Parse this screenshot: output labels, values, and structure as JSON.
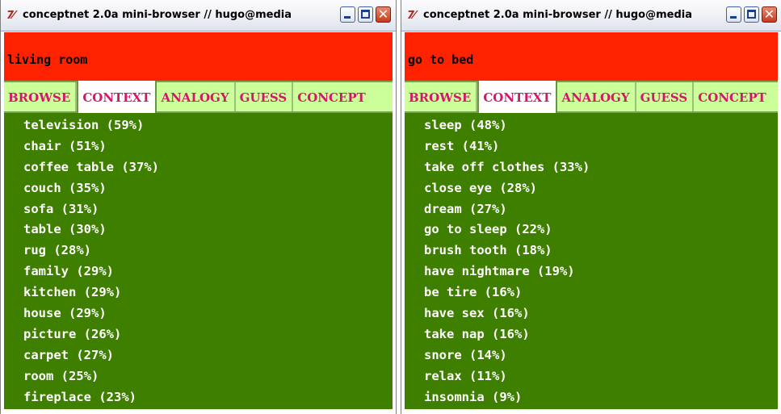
{
  "colors": {
    "input_bg": "#ff2200",
    "tab_bar_bg": "#ccff99",
    "tab_text": "#d5176b",
    "results_bg": "#3f7f00",
    "results_text": "#ffffff"
  },
  "windows": [
    {
      "title": "conceptnet 2.0a mini-browser // hugo@media",
      "app_icon": "tk-feather-icon",
      "concept": "living room",
      "tabs": [
        "BROWSE",
        "CONTEXT",
        "ANALOGY",
        "GUESS",
        "CONCEPT"
      ],
      "active_tab": "CONTEXT",
      "results": [
        "television (59%)",
        "chair (51%)",
        "coffee table (37%)",
        "couch (35%)",
        "sofa (31%)",
        "table (30%)",
        "rug (28%)",
        "family (29%)",
        "kitchen (29%)",
        "house (29%)",
        "picture (26%)",
        "carpet (27%)",
        "room (25%)",
        "fireplace (23%)"
      ]
    },
    {
      "title": "conceptnet 2.0a mini-browser // hugo@media",
      "app_icon": "tk-feather-icon",
      "concept": "go to bed",
      "tabs": [
        "BROWSE",
        "CONTEXT",
        "ANALOGY",
        "GUESS",
        "CONCEPT"
      ],
      "active_tab": "CONTEXT",
      "results": [
        "sleep (48%)",
        "rest (41%)",
        "take off clothes (33%)",
        "close eye (28%)",
        "dream (27%)",
        "go to sleep (22%)",
        "brush tooth (18%)",
        "have nightmare (19%)",
        "be tire (16%)",
        "have sex (16%)",
        "take nap (16%)",
        "snore (14%)",
        "relax (11%)",
        "insomnia (9%)"
      ]
    }
  ]
}
